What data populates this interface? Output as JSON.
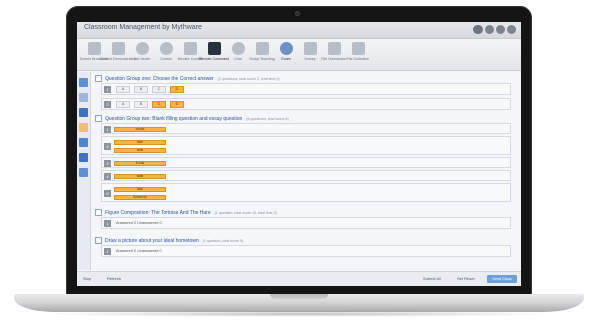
{
  "window": {
    "title": "Classroom Management by Mythware",
    "title_pill": "",
    "colors": {
      "accent": "#2d55a0",
      "selected_option": "#f5b348",
      "status_button": "#6e9fd6"
    }
  },
  "toolbar": {
    "items": [
      {
        "label": "Screen Broadcast",
        "icon": "screen-icon"
      },
      {
        "label": "Student Demonstration",
        "icon": "students-icon"
      },
      {
        "label": "Net Movie",
        "icon": "film-icon"
      },
      {
        "label": "Control",
        "icon": "control-icon"
      },
      {
        "label": "Monitor Control",
        "icon": "monitor-icon"
      },
      {
        "label": "Remote Command",
        "icon": "terminal-icon"
      },
      {
        "label": "Chat",
        "icon": "chat-icon"
      },
      {
        "label": "Group Teaching",
        "icon": "group-icon"
      },
      {
        "label": "Exam",
        "icon": "exam-icon"
      },
      {
        "label": "Survey",
        "icon": "survey-icon"
      },
      {
        "label": "File Submission",
        "icon": "file-icon"
      },
      {
        "label": "File Collection",
        "icon": "collect-icon"
      }
    ]
  },
  "groups": [
    {
      "title": "Question Group one: Choose the Correct answer",
      "subtitle": "(2 questions, total score 2, total time 0)",
      "questions": [
        {
          "num": "1",
          "options": [
            "A",
            "B",
            "C",
            "D"
          ],
          "selected": 3
        },
        {
          "num": "2",
          "options": [
            "A",
            "B",
            "C",
            "D"
          ],
          "selected": 2
        }
      ]
    },
    {
      "title": "Question Group two: Blank filling question and essay question",
      "subtitle": "(6 questions, total score 6)",
      "questions": [
        {
          "num": "1",
          "answers": [
            "words"
          ]
        },
        {
          "num": "2",
          "answers": [
            "take",
            "walk"
          ]
        },
        {
          "num": "3",
          "answers": [
            "it was"
          ]
        },
        {
          "num": "4",
          "answers": [
            "walk"
          ]
        },
        {
          "num": "5",
          "answers": [
            "take",
            "tomorrow"
          ]
        }
      ]
    },
    {
      "title": "Figure Composition: The Tortoise And The Hare",
      "subtitle": "(1 question, total score 10, total time 0)",
      "questions": [
        {
          "num": "1",
          "text": "Answered 0 Unanswered 0"
        }
      ]
    },
    {
      "title": "Draw a picture about your ideal hometown",
      "subtitle": "(1 question, total score 5)",
      "questions": [
        {
          "num": "1",
          "text": "Answered 0 Unanswered 0"
        }
      ]
    }
  ],
  "status": {
    "left1": "Stop",
    "left2": "Refresh",
    "right1": "Submit All",
    "right2": "Set Reset",
    "button": "Send Class"
  }
}
